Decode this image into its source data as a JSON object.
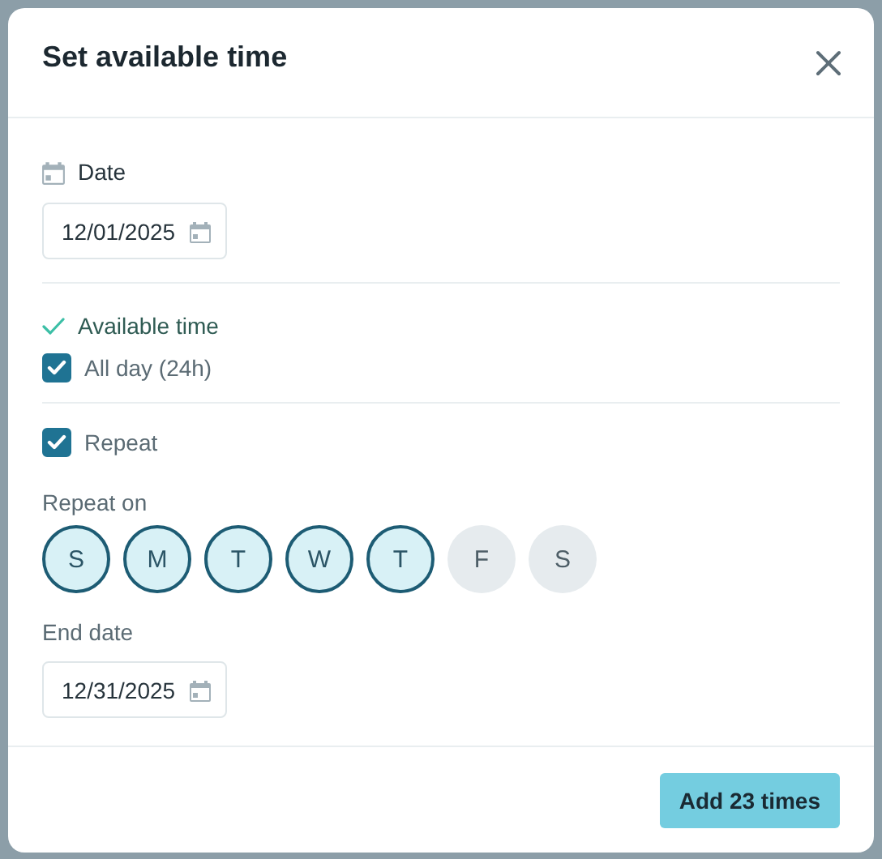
{
  "dialog": {
    "title": "Set available time"
  },
  "date": {
    "label": "Date",
    "value": "12/01/2025"
  },
  "available_time": {
    "label": "Available time"
  },
  "all_day": {
    "label": "All day (24h)",
    "checked": true
  },
  "repeat": {
    "label": "Repeat",
    "checked": true
  },
  "repeat_on": {
    "label": "Repeat on",
    "days": [
      {
        "label": "S",
        "selected": true
      },
      {
        "label": "M",
        "selected": true
      },
      {
        "label": "T",
        "selected": true
      },
      {
        "label": "W",
        "selected": true
      },
      {
        "label": "T",
        "selected": true
      },
      {
        "label": "F",
        "selected": false
      },
      {
        "label": "S",
        "selected": false
      }
    ]
  },
  "end_date": {
    "label": "End date",
    "value": "12/31/2025"
  },
  "footer": {
    "button": "Add 23 times"
  }
}
